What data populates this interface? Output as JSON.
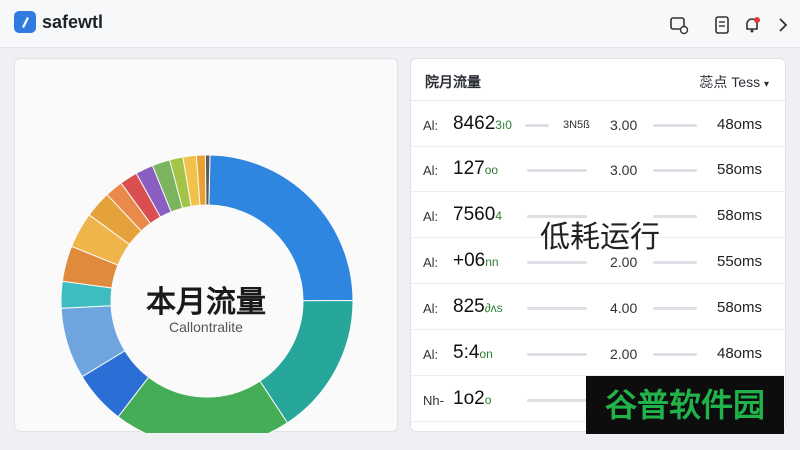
{
  "header": {
    "app_title": "safewtl",
    "icons": [
      "device-sync-icon",
      "document-icon",
      "notification-bell-icon",
      "chevron-right-icon"
    ],
    "accent": "#2f7be0",
    "notification_dot": "#e53935"
  },
  "left_panel": {
    "center_title": "本月流量",
    "center_subtitle": "Callontralite",
    "segments": [
      {
        "color": "#2f86e0",
        "value": 25
      },
      {
        "color": "#27a69a",
        "value": 16
      },
      {
        "color": "#45ac57",
        "value": 20
      },
      {
        "color": "#2b6fd6",
        "value": 6
      },
      {
        "color": "#6fa5de",
        "value": 8
      },
      {
        "color": "#3ebdc0",
        "value": 3
      },
      {
        "color": "#e08a3c",
        "value": 4
      },
      {
        "color": "#f0b54a",
        "value": 4
      },
      {
        "color": "#e6a23a",
        "value": 3
      },
      {
        "color": "#ea8a4a",
        "value": 2
      },
      {
        "color": "#d94f4f",
        "value": 2
      },
      {
        "color": "#8b5ec2",
        "value": 2
      },
      {
        "color": "#7cb35e",
        "value": 2
      },
      {
        "color": "#a4c447",
        "value": 1.5
      },
      {
        "color": "#f2c14a",
        "value": 1.5
      },
      {
        "color": "#e8a030",
        "value": 1
      },
      {
        "color": "#5a5a5a",
        "value": 0.5
      }
    ]
  },
  "right_panel": {
    "title": "院月流量",
    "filter_label": "蕊点 Tess",
    "status_text": "低耗运行",
    "rows": [
      {
        "label": "Al:",
        "number": "8462",
        "sub": "3ı0",
        "mid": "3N5ß",
        "value": "3.00",
        "ms": "48oms"
      },
      {
        "label": "Al:",
        "number": "127",
        "sub": "oo",
        "mid": "",
        "value": "3.00",
        "ms": "58oms"
      },
      {
        "label": "Al:",
        "number": "7560",
        "sub": "4",
        "mid": "",
        "value": "",
        "ms": "58oms"
      },
      {
        "label": "Al:",
        "number": "+06",
        "sub": "nn",
        "mid": "",
        "value": "2.00",
        "ms": "55oms"
      },
      {
        "label": "Al:",
        "number": "825",
        "sub": "∂ʌs",
        "mid": "",
        "value": "4.00",
        "ms": "58oms"
      },
      {
        "label": "Al:",
        "number": "5:4",
        "sub": "on",
        "mid": "",
        "value": "2.00",
        "ms": "48oms"
      },
      {
        "label": "Nh-",
        "number": "1o2",
        "sub": "o",
        "mid": "",
        "value": "",
        "ms": ""
      }
    ]
  },
  "watermark": {
    "text": "谷普软件园",
    "color": "#1fb34a"
  }
}
